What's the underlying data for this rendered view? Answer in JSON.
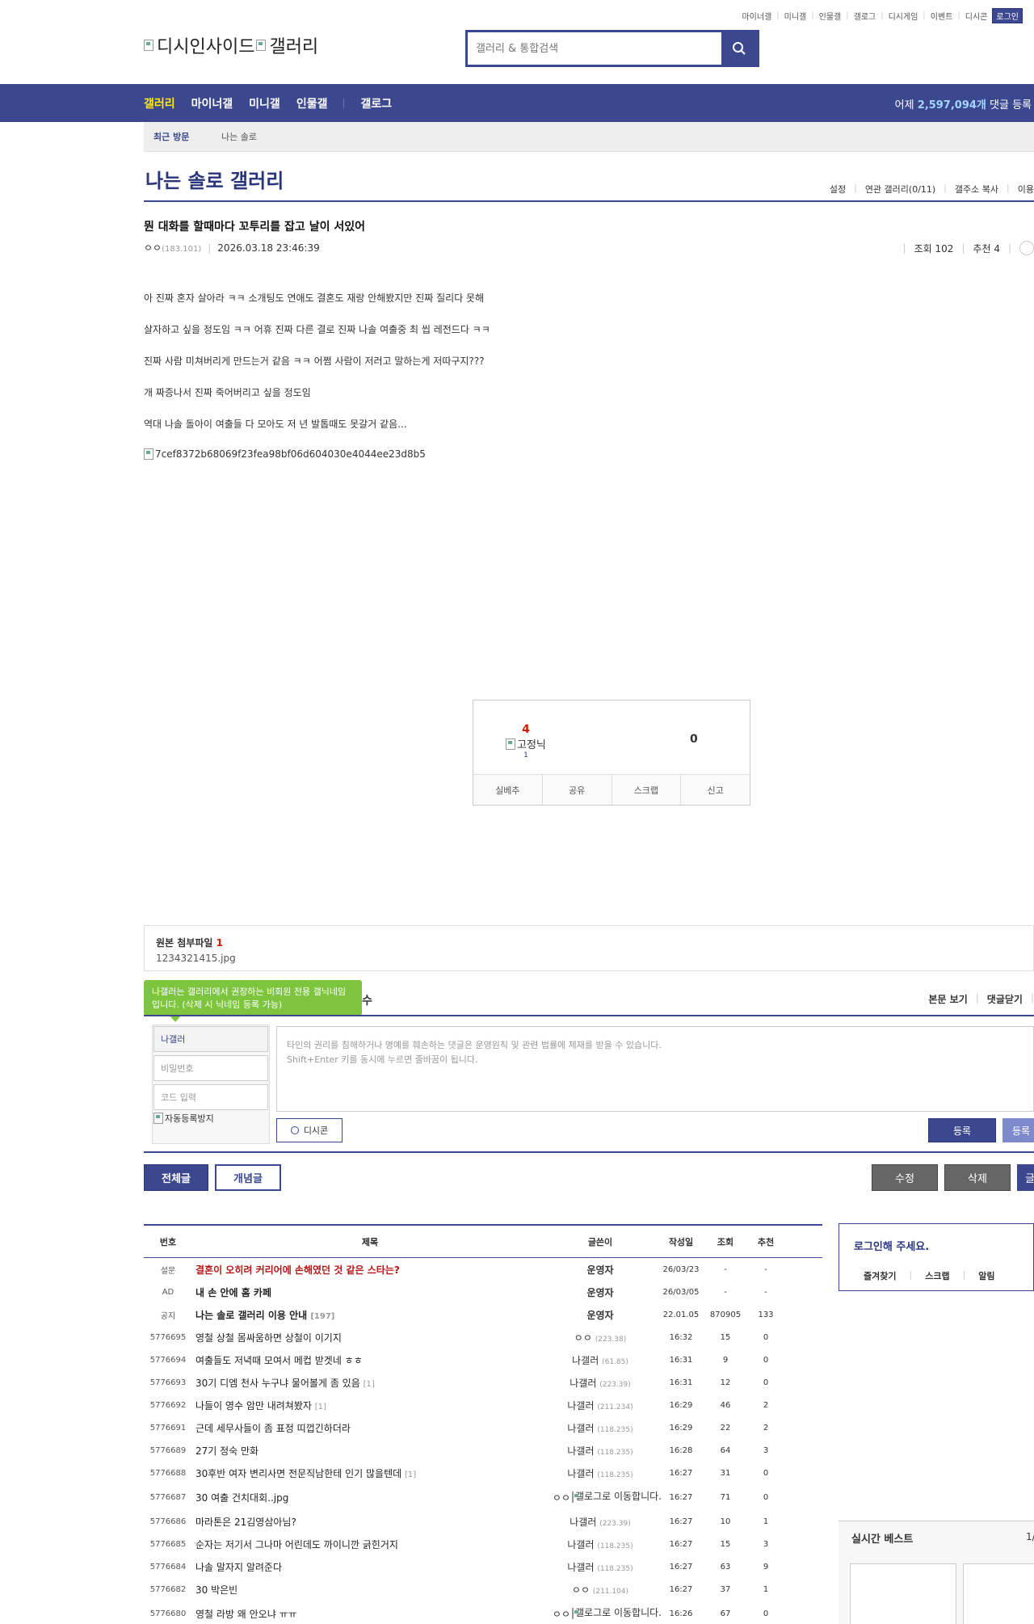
{
  "util": {
    "links": [
      "마이너갤",
      "미니갤",
      "인물갤",
      "갤로그",
      "디시게임",
      "이벤트",
      "디시콘"
    ],
    "login": "로그인"
  },
  "logo": {
    "part1": "디시인사이드",
    "part2": "갤러리"
  },
  "search": {
    "placeholder": "갤러리 & 통합검색"
  },
  "gnb": {
    "items": [
      "갤러리",
      "마이너갤",
      "미니갤",
      "인물갤",
      "갤로그"
    ],
    "counter_prefix": "어제",
    "counter_value": "2,597,094개",
    "counter_suffix": "댓글 등록"
  },
  "recent": {
    "label": "최근 방문",
    "item": "나는 솔로"
  },
  "gallery": {
    "title": "나는 솔로 갤러리",
    "tools": [
      "설정",
      "연관 갤러리(0/11)",
      "갤주소 복사",
      "이용"
    ]
  },
  "post": {
    "title": "뭔 대화를 할때마다 꼬투리를 잡고 날이 서있어",
    "author": "ㅇㅇ",
    "ip": "(183.101)",
    "date": "2026.03.18 23:46:39",
    "views": "조회 102",
    "recommend": "추천 4",
    "body": [
      "아 진짜 혼자 살아라 ㅋㅋ 소개팅도 연애도 결혼도 재랑 안해봤지만 진짜 질리다 못해",
      "살자하고 싶을 정도임 ㅋㅋ 어휴 진짜 다른 결로 진짜 나솔 여출중 최 씹 레전드다 ㅋㅋ",
      "진짜 사람 미쳐버리게 만드는거 같음 ㅋㅋ 어쩜 사람이 저러고 말하는게 저따구지???",
      "개 짜증나서 진짜 죽어버리고 싶을 정도임",
      "역대 나솔 돌아이 여출들 다 모아도 저 년 발톱때도 못갈거 같음..."
    ],
    "image_alt": "7cef8372b68069f23fea98bf06d604030e4044ee23d8b5"
  },
  "vote": {
    "up_count": "4",
    "fixed_label": "고정닉",
    "fixed_count": "1",
    "down_count": "0",
    "buttons": [
      "실베추",
      "공유",
      "스크랩",
      "신고"
    ]
  },
  "attach": {
    "label": "원본 첨부파일",
    "count": "1",
    "file": "1234321415.jpg"
  },
  "comment": {
    "tip": "나갤러는 갤러리에서 권장하는 비회원 전용 갤닉네임입니다. (삭제 시 닉네임 등록 가능)",
    "tip_tail": "수",
    "view_body": "본문 보기",
    "close": "댓글닫기",
    "nick": "나갤러",
    "password_placeholder": "비밀번호",
    "code_placeholder": "코드 입력",
    "captcha_alt": "자동등록방지",
    "textarea_placeholder": "타인의 권리를 침해하거나 명예를 훼손하는 댓글은 운영원칙 및 관련 법률에 제재를 받을 수 있습니다.",
    "textarea_hint": "Shift+Enter 키를 동시에 누르면 줄바꿈이 됩니다.",
    "dccon": "디시콘",
    "register": "등록",
    "register2": "등록"
  },
  "buttons": {
    "all": "전체글",
    "concept": "개념글",
    "edit": "수정",
    "delete": "삭제",
    "write": "글"
  },
  "list": {
    "headers": [
      "번호",
      "제목",
      "글쓴이",
      "작성일",
      "조회",
      "추천"
    ],
    "rows": [
      {
        "num": "설문",
        "title": "결혼이 오히려 커리어에 손해였던 것 같은 스타는?",
        "writer": "운영자",
        "ip": "",
        "date": "26/03/23",
        "views": "-",
        "rec": "-",
        "type": "survey"
      },
      {
        "num": "AD",
        "title": "내 손 안에 홈 카페",
        "writer": "운영자",
        "ip": "",
        "date": "26/03/05",
        "views": "-",
        "rec": "-",
        "type": "notice"
      },
      {
        "num": "공지",
        "title": "나는 솔로 갤러리 이용 안내",
        "reply": "[197]",
        "writer": "운영자",
        "ip": "",
        "date": "22.01.05",
        "views": "870905",
        "rec": "133",
        "type": "notice"
      },
      {
        "num": "5776695",
        "title": "영철 상철 몸싸움하면 상철이 이기지",
        "writer": "ㅇㅇ",
        "ip": "(223.38)",
        "date": "16:32",
        "views": "15",
        "rec": "0"
      },
      {
        "num": "5776694",
        "title": "여출들도 저녁때 모여서 메컵 받겟네 ㅎㅎ",
        "writer": "나갤러",
        "ip": "(61.85)",
        "date": "16:31",
        "views": "9",
        "rec": "0"
      },
      {
        "num": "5776693",
        "title": "30기 디엠 천사 누구냐 물어볼게 좀 있음",
        "reply": "[1]",
        "writer": "나갤러",
        "ip": "(223.39)",
        "date": "16:31",
        "views": "12",
        "rec": "0"
      },
      {
        "num": "5776692",
        "title": "나들이 영수 암만 내려쳐봤자",
        "reply": "[1]",
        "writer": "나갤러",
        "ip": "(211.234)",
        "date": "16:29",
        "views": "46",
        "rec": "2"
      },
      {
        "num": "5776691",
        "title": "근데 세무사들이 좀 표정 띠껍긴하더라",
        "writer": "나갤러",
        "ip": "(118.235)",
        "date": "16:29",
        "views": "22",
        "rec": "2"
      },
      {
        "num": "5776689",
        "title": "27기 정숙 만화",
        "writer": "나갤러",
        "ip": "(118.235)",
        "date": "16:28",
        "views": "64",
        "rec": "3"
      },
      {
        "num": "5776688",
        "title": "30후반 여자 변리사면 전문직남한테 인기 많을텐데",
        "reply": "[1]",
        "writer": "나갤러",
        "ip": "(118.235)",
        "date": "16:27",
        "views": "31",
        "rec": "0"
      },
      {
        "num": "5776687",
        "title": "30 여출 건치대회..jpg",
        "writer": "ㅇㅇ",
        "writer_img": "갤로그로 이동합니다.",
        "ip": "",
        "date": "16:27",
        "views": "71",
        "rec": "0",
        "tall": true
      },
      {
        "num": "5776686",
        "title": "마라톤은 21김영삼아님?",
        "writer": "나갤러",
        "ip": "(223.39)",
        "date": "16:27",
        "views": "10",
        "rec": "1"
      },
      {
        "num": "5776685",
        "title": "순자는 저기서 그나마 어린데도 까이니깐 긁힌거지",
        "writer": "나갤러",
        "ip": "(118.235)",
        "date": "16:27",
        "views": "15",
        "rec": "3"
      },
      {
        "num": "5776684",
        "title": "나솔 말자지 알려준다",
        "writer": "나갤러",
        "ip": "(118.235)",
        "date": "16:27",
        "views": "63",
        "rec": "9"
      },
      {
        "num": "5776682",
        "title": "30 박은빈",
        "writer": "ㅇㅇ",
        "ip": "(211.104)",
        "date": "16:27",
        "views": "37",
        "rec": "1"
      },
      {
        "num": "5776680",
        "title": "영철 라방 왜 안오냐 ㅠㅠ",
        "writer": "ㅇㅇ",
        "writer_img": "갤로그로 이동합니다.",
        "ip": "",
        "date": "16:26",
        "views": "67",
        "rec": "0",
        "tall": true
      }
    ]
  },
  "side": {
    "login_prompt": "로그인해 주세요.",
    "links": [
      "즐겨찾기",
      "스크랩",
      "알림"
    ],
    "best_title": "실시간 베스트",
    "best_page": "1/"
  }
}
